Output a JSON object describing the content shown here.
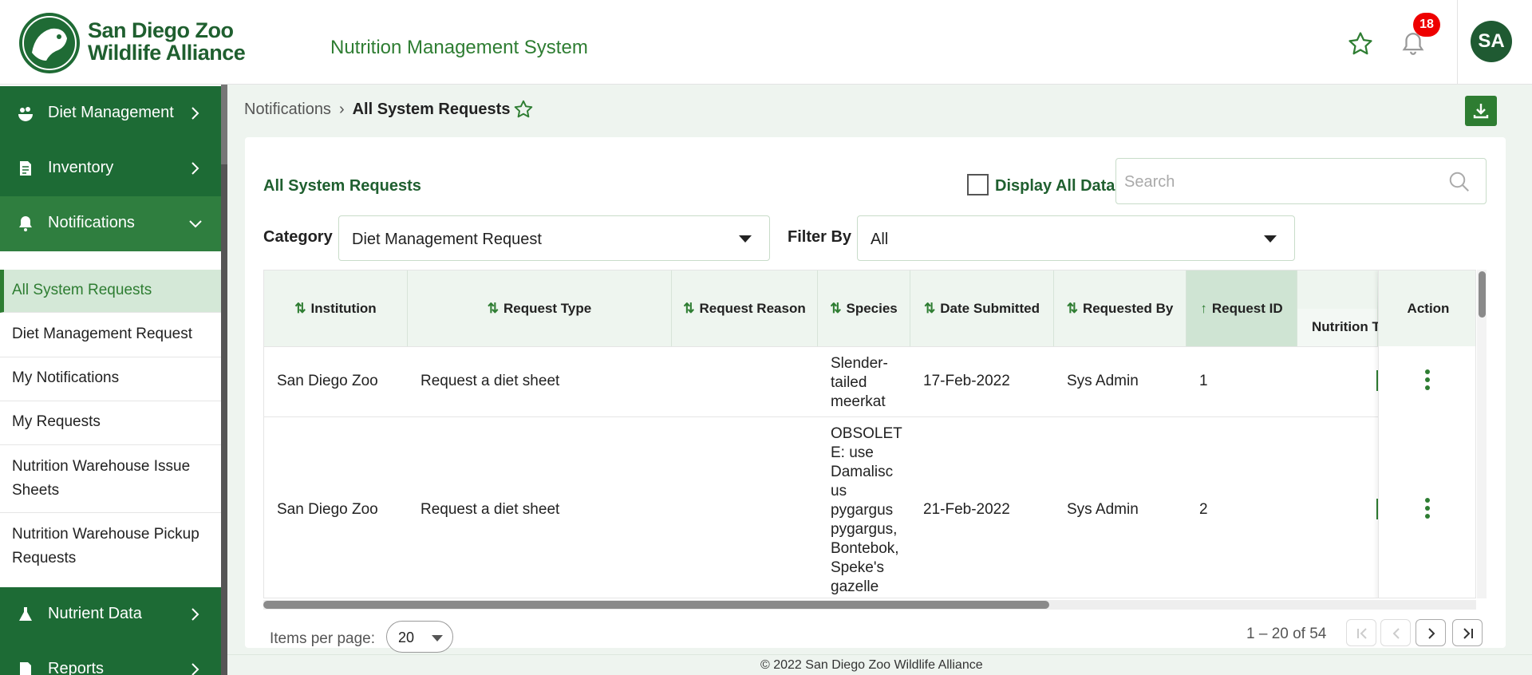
{
  "header": {
    "logo_line1": "San Diego Zoo",
    "logo_line2": "Wildlife Alliance",
    "app_title": "Nutrition Management System",
    "notification_count": "18",
    "avatar_initials": "SA"
  },
  "sidebar": {
    "items": [
      {
        "label": "Diet Management",
        "icon": "diet-icon"
      },
      {
        "label": "Inventory",
        "icon": "inventory-icon"
      },
      {
        "label": "Notifications",
        "icon": "bell-icon"
      },
      {
        "label": "Nutrient Data",
        "icon": "flask-icon"
      },
      {
        "label": "Reports",
        "icon": "report-icon"
      }
    ],
    "sub_items": [
      "All System Requests",
      "Diet Management Request",
      "My Notifications",
      "My Requests",
      "Nutrition Warehouse Issue Sheets",
      "Nutrition Warehouse Pickup Requests"
    ]
  },
  "breadcrumb": {
    "parent": "Notifications",
    "current": "All System Requests"
  },
  "card": {
    "title": "All System Requests",
    "display_all_label": "Display All Data",
    "search_placeholder": "Search",
    "category_label": "Category",
    "category_value": "Diet Management Request",
    "filter_label": "Filter By",
    "filter_value": "All"
  },
  "table": {
    "columns": [
      "Institution",
      "Request Type",
      "Request Reason",
      "Species",
      "Date Submitted",
      "Requested By",
      "Request ID",
      "Nutrition T",
      "Action"
    ],
    "sort_column": "Request ID",
    "rows": [
      {
        "institution": "San Diego Zoo",
        "request_type": "Request a diet sheet",
        "request_reason": "",
        "species": [
          "Slender-",
          "tailed",
          "meerkat"
        ],
        "date": "17-Feb-2022",
        "requested_by": "Sys Admin",
        "request_id": "1"
      },
      {
        "institution": "San Diego Zoo",
        "request_type": "Request a diet sheet",
        "request_reason": "",
        "species": [
          "OBSOLET",
          "E: use",
          "Damalisc",
          "us",
          "pygargus",
          "pygargus,",
          "Bontebok,",
          "Speke's",
          "gazelle"
        ],
        "date": "21-Feb-2022",
        "requested_by": "Sys Admin",
        "request_id": "2"
      }
    ]
  },
  "paginator": {
    "items_per_page_label": "Items per page:",
    "items_per_page": "20",
    "range": "1 – 20 of 54"
  },
  "footer": {
    "copyright": "© 2022 San Diego Zoo Wildlife Alliance"
  },
  "colors": {
    "brand_dark": "#1d6b35",
    "brand_green": "#2e7d32",
    "badge_red": "#ee0000"
  }
}
